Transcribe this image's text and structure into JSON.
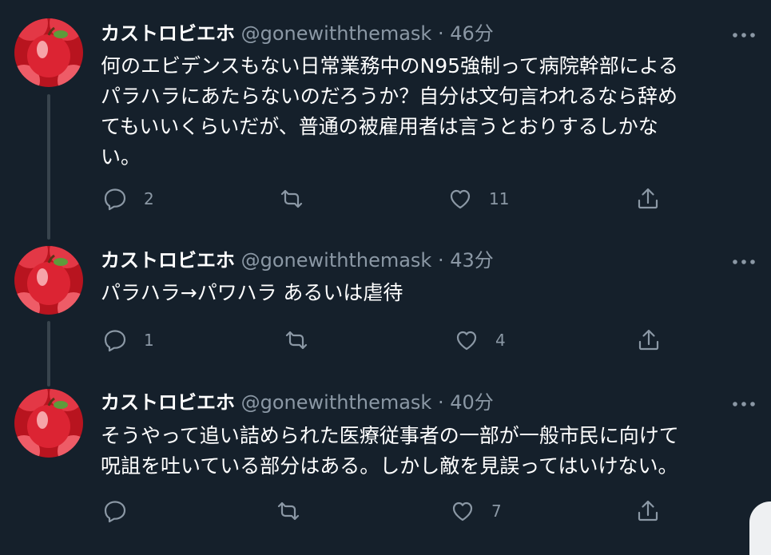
{
  "theme": {
    "background": "#15202b",
    "text": "#ffffff",
    "secondary": "#8b98a5",
    "thread_line": "#38444d",
    "avatar_red": "#d8202c"
  },
  "author": {
    "name": "カストロビエホ",
    "handle": "@gonewiththemask"
  },
  "tweets": [
    {
      "time": "· 46分",
      "text_lines": [
        "何のエビデンスもない日常業務中のN95強制って病院幹部による",
        "パラハラにあたらないのだろうか？自分は文句言われるなら辞め",
        "てもいいくらいだが、普通の被雇用者は言うとおりするしかな",
        "い。"
      ],
      "replies": "2",
      "retweets": "",
      "likes": "11"
    },
    {
      "time": "· 43分",
      "text_lines": [
        "パラハラ→パワハラ あるいは虐待"
      ],
      "replies": "1",
      "retweets": "",
      "likes": "4"
    },
    {
      "time": "· 40分",
      "text_lines": [
        "そうやって追い詰められた医療従事者の一部が一般市民に向けて",
        "呪詛を吐いている部分はある。しかし敵を見誤ってはいけない。"
      ],
      "replies": "",
      "retweets": "",
      "likes": "7"
    }
  ],
  "icons": {
    "reply": "reply-icon",
    "retweet": "retweet-icon",
    "like": "heart-icon",
    "share": "share-icon",
    "more": "more-icon",
    "avatar": "apple-avatar"
  }
}
